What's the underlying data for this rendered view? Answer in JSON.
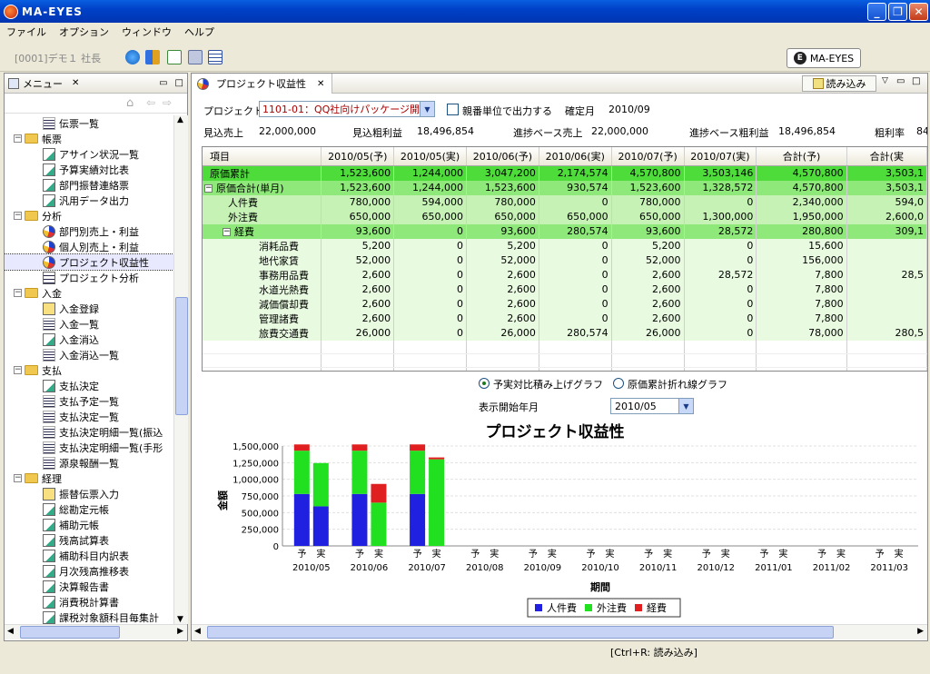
{
  "window": {
    "title": "MA-EYES"
  },
  "menu": [
    "ファイル",
    "オプション",
    "ウィンドウ",
    "ヘルプ"
  ],
  "toolbar": {
    "user": "[0001]デモ１ 社長",
    "app_button": "MA-EYES"
  },
  "left_panel": {
    "title": "メニュー",
    "tree": [
      {
        "level": 2,
        "icon": "list",
        "label": "伝票一覧"
      },
      {
        "level": 1,
        "folder": true,
        "label": "帳票"
      },
      {
        "level": 2,
        "icon": "rep",
        "label": "アサイン状況一覧"
      },
      {
        "level": 2,
        "icon": "rep",
        "label": "予算実績対比表"
      },
      {
        "level": 2,
        "icon": "rep",
        "label": "部門振替連絡票"
      },
      {
        "level": 2,
        "icon": "rep",
        "label": "汎用データ出力"
      },
      {
        "level": 1,
        "folder": true,
        "label": "分析"
      },
      {
        "level": 2,
        "icon": "pie",
        "label": "部門別売上・利益"
      },
      {
        "level": 2,
        "icon": "pie",
        "label": "個人別売上・利益"
      },
      {
        "level": 2,
        "icon": "pie",
        "label": "プロジェクト収益性",
        "selected": true
      },
      {
        "level": 2,
        "icon": "grid",
        "label": "プロジェクト分析"
      },
      {
        "level": 1,
        "folder": true,
        "label": "入金"
      },
      {
        "level": 2,
        "icon": "in",
        "label": "入金登録"
      },
      {
        "level": 2,
        "icon": "list",
        "label": "入金一覧"
      },
      {
        "level": 2,
        "icon": "rep",
        "label": "入金消込"
      },
      {
        "level": 2,
        "icon": "list",
        "label": "入金消込一覧"
      },
      {
        "level": 1,
        "folder": true,
        "label": "支払"
      },
      {
        "level": 2,
        "icon": "rep",
        "label": "支払決定"
      },
      {
        "level": 2,
        "icon": "list",
        "label": "支払予定一覧"
      },
      {
        "level": 2,
        "icon": "list",
        "label": "支払決定一覧"
      },
      {
        "level": 2,
        "icon": "list",
        "label": "支払決定明細一覧(振込"
      },
      {
        "level": 2,
        "icon": "list",
        "label": "支払決定明細一覧(手形"
      },
      {
        "level": 2,
        "icon": "list",
        "label": "源泉報酬一覧"
      },
      {
        "level": 1,
        "folder": true,
        "label": "経理"
      },
      {
        "level": 2,
        "icon": "in",
        "label": "振替伝票入力"
      },
      {
        "level": 2,
        "icon": "rep",
        "label": "総勘定元帳"
      },
      {
        "level": 2,
        "icon": "rep",
        "label": "補助元帳"
      },
      {
        "level": 2,
        "icon": "rep",
        "label": "残高試算表"
      },
      {
        "level": 2,
        "icon": "rep",
        "label": "補助科目内訳表"
      },
      {
        "level": 2,
        "icon": "rep",
        "label": "月次残高推移表"
      },
      {
        "level": 2,
        "icon": "rep",
        "label": "決算報告書"
      },
      {
        "level": 2,
        "icon": "rep",
        "label": "消費税計算書"
      },
      {
        "level": 2,
        "icon": "rep",
        "label": "課税対象額科目毎集計"
      }
    ]
  },
  "main": {
    "tab": "プロジェクト収益性",
    "read_button": "読み込み",
    "project_label": "プロジェクト",
    "project_value": "1101-01：QQ社向けパッケージ開発",
    "parent_unit_label": "親番単位で出力する",
    "confirmed_label": "確定月",
    "confirmed_value": "2010/09",
    "summary": [
      {
        "label": "見込売上",
        "value": "22,000,000"
      },
      {
        "label": "見込粗利益",
        "value": "18,496,854"
      },
      {
        "label": "進捗ベース売上",
        "value": "22,000,000"
      },
      {
        "label": "進捗ベース粗利益",
        "value": "18,496,854"
      },
      {
        "label": "粗利率",
        "value": "84"
      }
    ],
    "table": {
      "headers": [
        "項目",
        "2010/05(予)",
        "2010/05(実)",
        "2010/06(予)",
        "2010/06(実)",
        "2010/07(予)",
        "2010/07(実)",
        "合計(予)",
        "合計(実"
      ],
      "rows": [
        {
          "cls": "g1",
          "indent": 0,
          "tog": "",
          "cells": [
            "原価累計",
            "1,523,600",
            "1,244,000",
            "3,047,200",
            "2,174,574",
            "4,570,800",
            "3,503,146",
            "4,570,800",
            "3,503,1"
          ]
        },
        {
          "cls": "g2",
          "indent": 0,
          "tog": "−",
          "cells": [
            "原価合計(単月)",
            "1,523,600",
            "1,244,000",
            "1,523,600",
            "930,574",
            "1,523,600",
            "1,328,572",
            "4,570,800",
            "3,503,1"
          ]
        },
        {
          "cls": "g3",
          "indent": 1,
          "tog": "",
          "cells": [
            "人件費",
            "780,000",
            "594,000",
            "780,000",
            "0",
            "780,000",
            "0",
            "2,340,000",
            "594,0"
          ]
        },
        {
          "cls": "g3",
          "indent": 1,
          "tog": "",
          "cells": [
            "外注費",
            "650,000",
            "650,000",
            "650,000",
            "650,000",
            "650,000",
            "1,300,000",
            "1,950,000",
            "2,600,0"
          ]
        },
        {
          "cls": "g2",
          "indent": 1,
          "tog": "−",
          "cells": [
            "経費",
            "93,600",
            "0",
            "93,600",
            "280,574",
            "93,600",
            "28,572",
            "280,800",
            "309,1"
          ]
        },
        {
          "cls": "g4",
          "indent": 2,
          "tog": "",
          "cells": [
            "消耗品費",
            "5,200",
            "0",
            "5,200",
            "0",
            "5,200",
            "0",
            "15,600",
            ""
          ]
        },
        {
          "cls": "g4",
          "indent": 2,
          "tog": "",
          "cells": [
            "地代家賃",
            "52,000",
            "0",
            "52,000",
            "0",
            "52,000",
            "0",
            "156,000",
            ""
          ]
        },
        {
          "cls": "g4",
          "indent": 2,
          "tog": "",
          "cells": [
            "事務用品費",
            "2,600",
            "0",
            "2,600",
            "0",
            "2,600",
            "28,572",
            "7,800",
            "28,5"
          ]
        },
        {
          "cls": "g4",
          "indent": 2,
          "tog": "",
          "cells": [
            "水道光熱費",
            "2,600",
            "0",
            "2,600",
            "0",
            "2,600",
            "0",
            "7,800",
            ""
          ]
        },
        {
          "cls": "g4",
          "indent": 2,
          "tog": "",
          "cells": [
            "減価償却費",
            "2,600",
            "0",
            "2,600",
            "0",
            "2,600",
            "0",
            "7,800",
            ""
          ]
        },
        {
          "cls": "g4",
          "indent": 2,
          "tog": "",
          "cells": [
            "管理諸費",
            "2,600",
            "0",
            "2,600",
            "0",
            "2,600",
            "0",
            "7,800",
            ""
          ]
        },
        {
          "cls": "g4",
          "indent": 2,
          "tog": "",
          "cells": [
            "旅費交通費",
            "26,000",
            "0",
            "26,000",
            "280,574",
            "26,000",
            "0",
            "78,000",
            "280,5"
          ]
        }
      ]
    },
    "radio1": "予実対比積み上げグラフ",
    "radio2": "原価累計折れ線グラフ",
    "start_label": "表示開始年月",
    "start_value": "2010/05"
  },
  "chart_data": {
    "type": "bar",
    "title": "プロジェクト収益性",
    "xlabel": "期間",
    "ylabel": "金額",
    "ylim": [
      0,
      1500000
    ],
    "yticks": [
      "0",
      "250,000",
      "500,000",
      "750,000",
      "1,000,000",
      "1,250,000",
      "1,500,000"
    ],
    "categories": [
      "2010/05",
      "2010/06",
      "2010/07",
      "2010/08",
      "2010/09",
      "2010/10",
      "2010/11",
      "2010/12",
      "2011/01",
      "2011/02",
      "2011/03"
    ],
    "sub_labels": [
      "予",
      "実"
    ],
    "series": [
      {
        "name": "人件費",
        "color": "#2020e0",
        "values": [
          [
            780000,
            594000
          ],
          [
            780000,
            0
          ],
          [
            780000,
            0
          ],
          [
            0,
            0
          ],
          [
            0,
            0
          ],
          [
            0,
            0
          ],
          [
            0,
            0
          ],
          [
            0,
            0
          ],
          [
            0,
            0
          ],
          [
            0,
            0
          ],
          [
            0,
            0
          ]
        ]
      },
      {
        "name": "外注費",
        "color": "#20e020",
        "values": [
          [
            650000,
            650000
          ],
          [
            650000,
            650000
          ],
          [
            650000,
            1300000
          ],
          [
            0,
            0
          ],
          [
            0,
            0
          ],
          [
            0,
            0
          ],
          [
            0,
            0
          ],
          [
            0,
            0
          ],
          [
            0,
            0
          ],
          [
            0,
            0
          ],
          [
            0,
            0
          ]
        ]
      },
      {
        "name": "経費",
        "color": "#e02020",
        "values": [
          [
            93600,
            0
          ],
          [
            93600,
            280574
          ],
          [
            93600,
            28572
          ],
          [
            0,
            0
          ],
          [
            0,
            0
          ],
          [
            0,
            0
          ],
          [
            0,
            0
          ],
          [
            0,
            0
          ],
          [
            0,
            0
          ],
          [
            0,
            0
          ],
          [
            0,
            0
          ]
        ]
      }
    ]
  },
  "status": {
    "hint": "[Ctrl+R: 読み込み]"
  }
}
